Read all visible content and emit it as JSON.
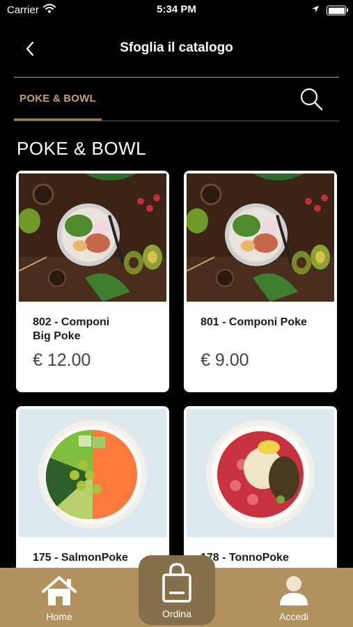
{
  "status_bar": {
    "carrier": "Carrier",
    "time": "5:34 PM"
  },
  "nav": {
    "title": "Sfoglia il catalogo"
  },
  "tabs": [
    {
      "label": "POKE & BOWL",
      "active": true
    }
  ],
  "section": {
    "title": "POKE & BOWL"
  },
  "products": [
    {
      "name": "802 - Componi\nBig Poke",
      "price": "€ 12.00"
    },
    {
      "name": "801 - Componi Poke",
      "price": "€ 9.00"
    },
    {
      "name": "175 - SalmonPoke",
      "price": ""
    },
    {
      "name": "178 - TonnoPoke",
      "price": ""
    }
  ],
  "bottom_nav": {
    "home": "Home",
    "ordina": "Ordina",
    "accedi": "Accedi"
  },
  "colors": {
    "accent": "#c7a26a",
    "tab_underline": "#9b7a4f",
    "bottom_bar": "#b1925f",
    "ordina_button": "#86704b"
  },
  "icons": [
    "wifi-icon",
    "location-arrow-icon",
    "battery-icon",
    "back-chevron-icon",
    "search-icon",
    "home-icon",
    "shopping-bag-icon",
    "user-icon"
  ]
}
